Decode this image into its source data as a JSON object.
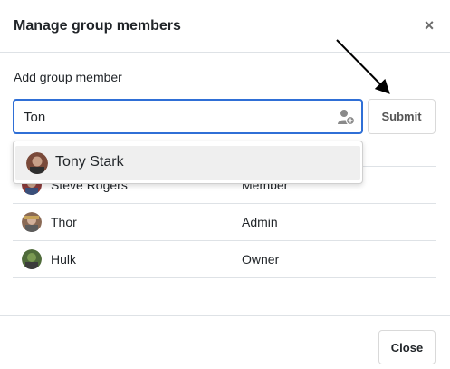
{
  "dialog": {
    "title": "Manage group members",
    "close_icon": "close-x-icon"
  },
  "add_member": {
    "label": "Add group member",
    "search_value": "Ton",
    "add_user_icon": "add-user-icon",
    "submit_label": "Submit"
  },
  "suggestions": [
    {
      "name": "Tony Stark",
      "avatar_color": "#7a4a3a"
    }
  ],
  "members": [
    {
      "name": "Steve Rogers",
      "role": "Member",
      "avatar_color": "#8a3b3b"
    },
    {
      "name": "Thor",
      "role": "Admin",
      "avatar_color": "#8a6a55"
    },
    {
      "name": "Hulk",
      "role": "Owner",
      "avatar_color": "#4f6b3a"
    }
  ],
  "footer": {
    "close_label": "Close"
  },
  "colors": {
    "focus_border": "#2f6fd6",
    "highlight": "#efefef",
    "divider": "#dee2e6"
  }
}
